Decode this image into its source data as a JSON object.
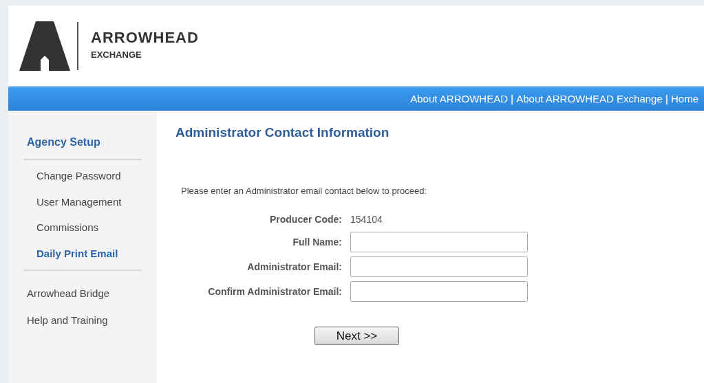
{
  "logo": {
    "name": "ARROWHEAD",
    "subtitle": "EXCHANGE"
  },
  "nav": [
    {
      "kind": "link",
      "label": "About ARROWHEAD"
    },
    {
      "kind": "separator",
      "label": "|"
    },
    {
      "kind": "link",
      "label": "About ARROWHEAD Exchange"
    },
    {
      "kind": "separator",
      "label": "|"
    },
    {
      "kind": "link",
      "label": "Home"
    }
  ],
  "sidebar": {
    "heading": "Agency Setup",
    "subitems": [
      {
        "label": "Change Password",
        "selected": false
      },
      {
        "label": "User Management",
        "selected": false
      },
      {
        "label": "Commissions",
        "selected": false
      },
      {
        "label": "Daily Print Email",
        "selected": true
      }
    ],
    "items": [
      {
        "label": "Arrowhead Bridge"
      },
      {
        "label": "Help and Training"
      }
    ]
  },
  "page_title": "Administrator Contact Information",
  "instructions": "Please enter an Administrator email contact below to proceed:",
  "form": [
    {
      "kind": "static",
      "label": "Producer Code:",
      "value": "154104"
    },
    {
      "kind": "input",
      "label": "Full Name:"
    },
    {
      "kind": "input",
      "label": "Administrator Email:"
    },
    {
      "kind": "input",
      "label": "Confirm Administrator Email:"
    }
  ],
  "button": "Next >>"
}
